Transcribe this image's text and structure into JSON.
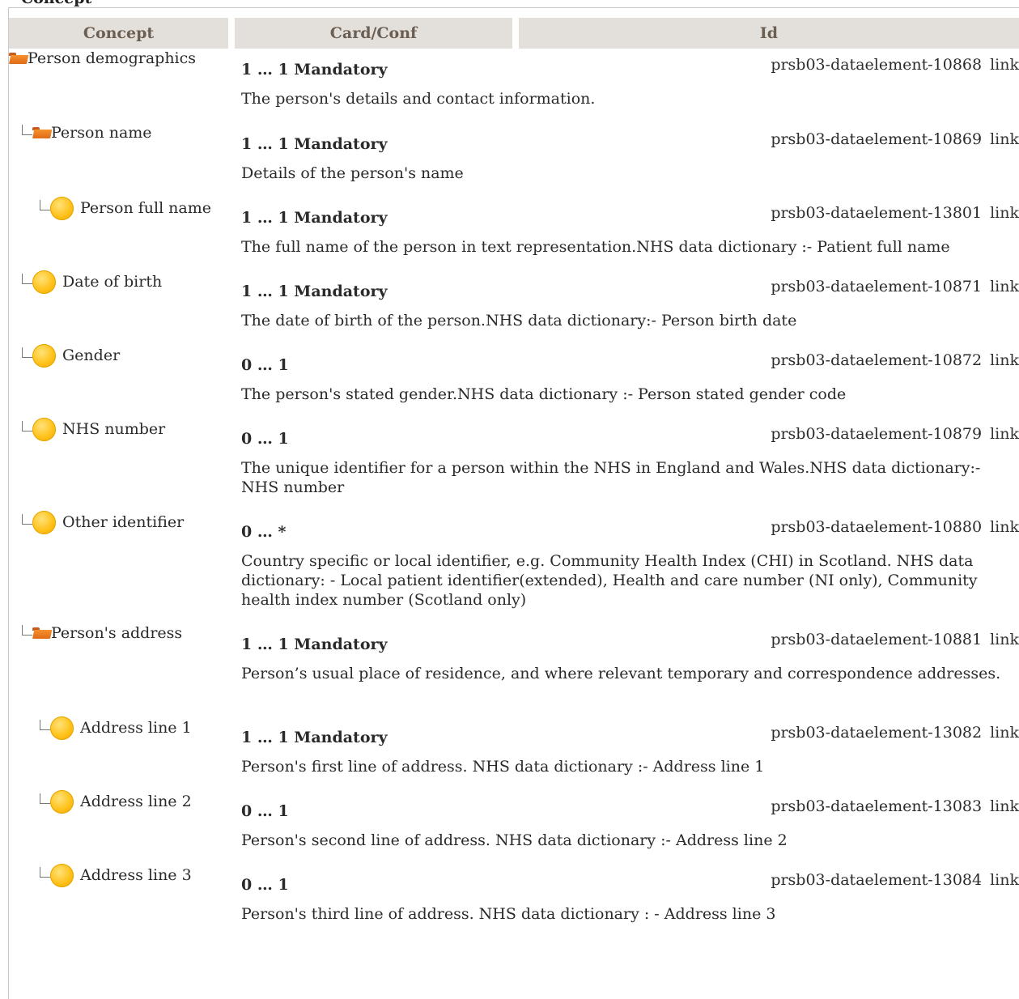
{
  "header_fragment": "Concept",
  "columns": [
    "Concept",
    "Card/Conf",
    "Id"
  ],
  "rows": [
    {
      "concept": "Person demographics",
      "icon": "folder-icon",
      "level": 0,
      "card": "1 … 1 Mandatory",
      "id": "prsb03-dataelement-10868",
      "link": "link",
      "desc": "The person's details and contact information."
    },
    {
      "concept": "Person name",
      "icon": "folder-icon",
      "level": 1,
      "card": "1 … 1 Mandatory",
      "id": "prsb03-dataelement-10869",
      "link": "link",
      "desc": "Details of the person's name"
    },
    {
      "concept": "Person full name",
      "icon": "leaf-icon",
      "level": 2,
      "card": "1 … 1 Mandatory",
      "id": "prsb03-dataelement-13801",
      "link": "link",
      "desc": "The full name of the person in text representation.NHS data dictionary :- Patient full name"
    },
    {
      "concept": "Date of birth",
      "icon": "leaf-icon",
      "level": 1,
      "card": "1 … 1 Mandatory",
      "id": "prsb03-dataelement-10871",
      "link": "link",
      "desc": "The date of birth of the person.NHS data dictionary:- Person birth date"
    },
    {
      "concept": "Gender",
      "icon": "leaf-icon",
      "level": 1,
      "card": "0 … 1",
      "id": "prsb03-dataelement-10872",
      "link": "link",
      "desc": "The person's stated gender.NHS data dictionary :- Person stated gender code"
    },
    {
      "concept": "NHS number",
      "icon": "leaf-icon",
      "level": 1,
      "card": "0 … 1",
      "id": "prsb03-dataelement-10879",
      "link": "link",
      "desc": "The unique identifier for a person within the NHS in England and Wales.NHS data dictionary:- NHS number"
    },
    {
      "concept": "Other identifier",
      "icon": "leaf-icon",
      "level": 1,
      "card": "0 … *",
      "id": "prsb03-dataelement-10880",
      "link": "link",
      "desc": "Country specific or local identifier, e.g. Community Health Index (CHI) in Scotland. NHS data dictionary: - Local patient identifier(extended), Health and care number (NI only), Community health index number (Scotland only)"
    },
    {
      "concept": "Person's address",
      "icon": "folder-icon",
      "level": 1,
      "card": "1 … 1 Mandatory",
      "id": "prsb03-dataelement-10881",
      "link": "link",
      "desc": "Person’s usual place of residence, and where relevant temporary and correspondence addresses."
    },
    {
      "concept": "Address line 1",
      "icon": "leaf-icon",
      "level": 2,
      "card": "1 … 1 Mandatory",
      "id": "prsb03-dataelement-13082",
      "link": "link",
      "desc": "Person's first line of address. NHS data dictionary :-  Address line 1"
    },
    {
      "concept": "Address line 2",
      "icon": "leaf-icon",
      "level": 2,
      "card": "0 … 1",
      "id": "prsb03-dataelement-13083",
      "link": "link",
      "desc": "Person's second line of address. NHS data dictionary :- Address line 2"
    },
    {
      "concept": "Address line 3",
      "icon": "leaf-icon",
      "level": 2,
      "card": "0 … 1",
      "id": "prsb03-dataelement-13084",
      "link": "link",
      "desc": "Person's third line of address. NHS data dictionary : - Address line 3"
    }
  ]
}
